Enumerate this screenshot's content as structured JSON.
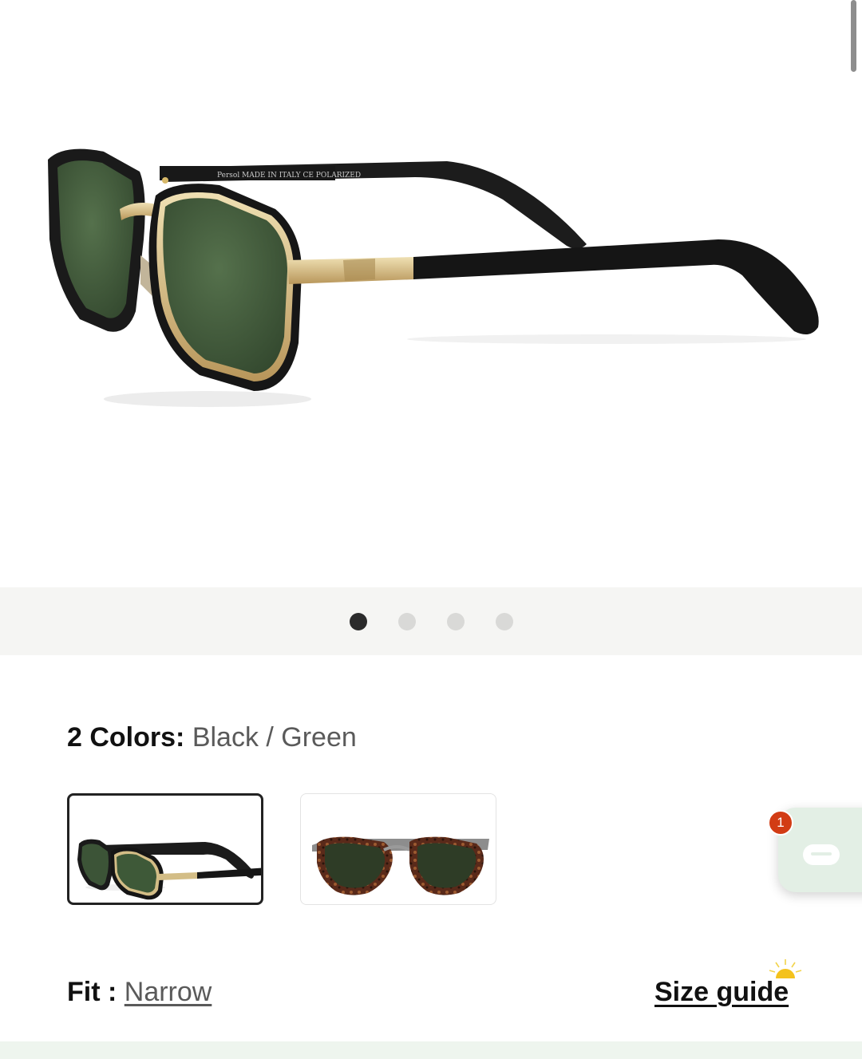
{
  "gallery": {
    "image_alt": "Black / Green sunglasses side view",
    "frame_print": "Persol MADE IN ITALY CE POLARIZED",
    "dots": [
      {
        "active": true
      },
      {
        "active": false
      },
      {
        "active": false
      },
      {
        "active": false
      }
    ]
  },
  "colors": {
    "label": "2 Colors:",
    "selected": "Black / Green",
    "options": [
      {
        "name": "Black / Green",
        "selected": true
      },
      {
        "name": "Havana / Green",
        "selected": false
      }
    ]
  },
  "fit": {
    "label": "Fit :",
    "value": "Narrow"
  },
  "size_guide": {
    "label": "Size guide"
  },
  "chat": {
    "badge_count": "1",
    "icon": "chat-bubble-icon"
  },
  "theme": {
    "accent": "#d23c14",
    "chat_bg": "#e3efe5",
    "lens": "#3f5a3a",
    "gold": "#c9b07a"
  }
}
